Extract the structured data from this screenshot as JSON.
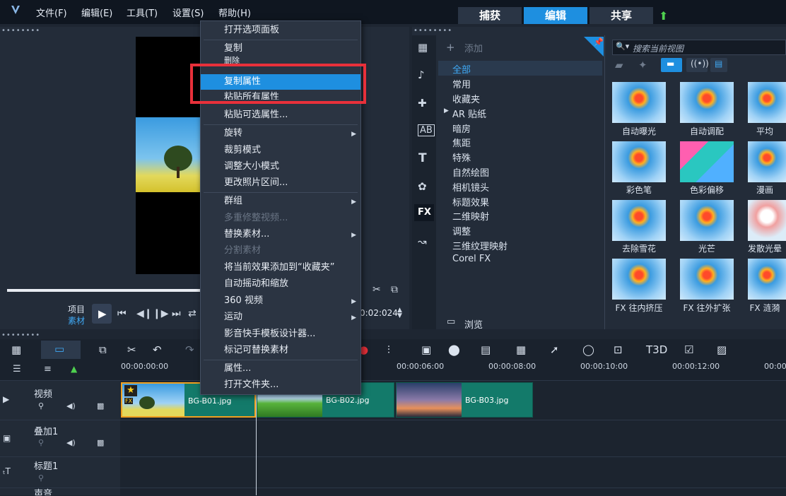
{
  "menubar": {
    "items": [
      "文件(F)",
      "编辑(E)",
      "工具(T)",
      "设置(S)",
      "帮助(H)"
    ]
  },
  "modes": {
    "capture": "捕获",
    "edit": "编辑",
    "share": "共享"
  },
  "preview": {
    "project_label": "项目",
    "clip_label": "素材",
    "timecode": "0:02:024"
  },
  "context_menu": {
    "items": [
      {
        "label": "打开选项面板",
        "disabled": false
      },
      {
        "label": "复制",
        "disabled": false
      },
      {
        "label": "删除",
        "disabled": false
      },
      {
        "label": "复制属性",
        "disabled": false,
        "highlighted": true
      },
      {
        "label": "粘贴所有属性",
        "disabled": false
      },
      {
        "label": "粘贴可选属性...",
        "disabled": false
      },
      {
        "label": "旋转",
        "disabled": false,
        "submenu": true
      },
      {
        "label": "裁剪模式",
        "disabled": false
      },
      {
        "label": "调整大小模式",
        "disabled": false
      },
      {
        "label": "更改照片区间...",
        "disabled": false
      },
      {
        "label": "群组",
        "disabled": false,
        "submenu": true
      },
      {
        "label": "多重修整视频...",
        "disabled": true
      },
      {
        "label": "替换素材...",
        "disabled": false,
        "submenu": true
      },
      {
        "label": "分割素材",
        "disabled": true
      },
      {
        "label": "将当前效果添加到“收藏夹”",
        "disabled": false
      },
      {
        "label": "自动摇动和缩放",
        "disabled": false
      },
      {
        "label": "360 视频",
        "disabled": false,
        "submenu": true
      },
      {
        "label": "运动",
        "disabled": false,
        "submenu": true
      },
      {
        "label": "影音快手模板设计器...",
        "disabled": false
      },
      {
        "label": "标记可替换素材",
        "disabled": false
      },
      {
        "label": "属性...",
        "disabled": false
      },
      {
        "label": "打开文件夹...",
        "disabled": false
      }
    ]
  },
  "library": {
    "add_label": "添加",
    "search_placeholder": "搜索当前视图",
    "fx_label": "FX",
    "browse_label": "浏览",
    "categories": [
      "全部",
      "常用",
      "收藏夹",
      "AR 贴纸",
      "暗房",
      "焦距",
      "特殊",
      "自然绘图",
      "相机镜头",
      "标题效果",
      "二维映射",
      "调整",
      "三维纹理映射",
      "Corel FX"
    ],
    "effects": [
      "自动曝光",
      "自动调配",
      "平均",
      "彩色笔",
      "色彩偏移",
      "漫画",
      "去除雪花",
      "光芒",
      "发散光晕",
      "FX 往内挤压",
      "FX 往外扩张",
      "FX 涟漪"
    ]
  },
  "timeline": {
    "ruler": [
      "00:00:00:00",
      "00:00:06:00",
      "00:00:08:00",
      "00:00:10:00",
      "00:00:12:00",
      "00:00"
    ],
    "tracks": [
      {
        "name": "视频"
      },
      {
        "name": "叠加1"
      },
      {
        "name": "标题1"
      },
      {
        "name": "声音"
      }
    ],
    "clips": [
      "BG-B01.jpg",
      "BG-B02.jpg",
      "BG-B03.jpg"
    ],
    "fx_badge": "FX",
    "title_tool": "T3D"
  }
}
